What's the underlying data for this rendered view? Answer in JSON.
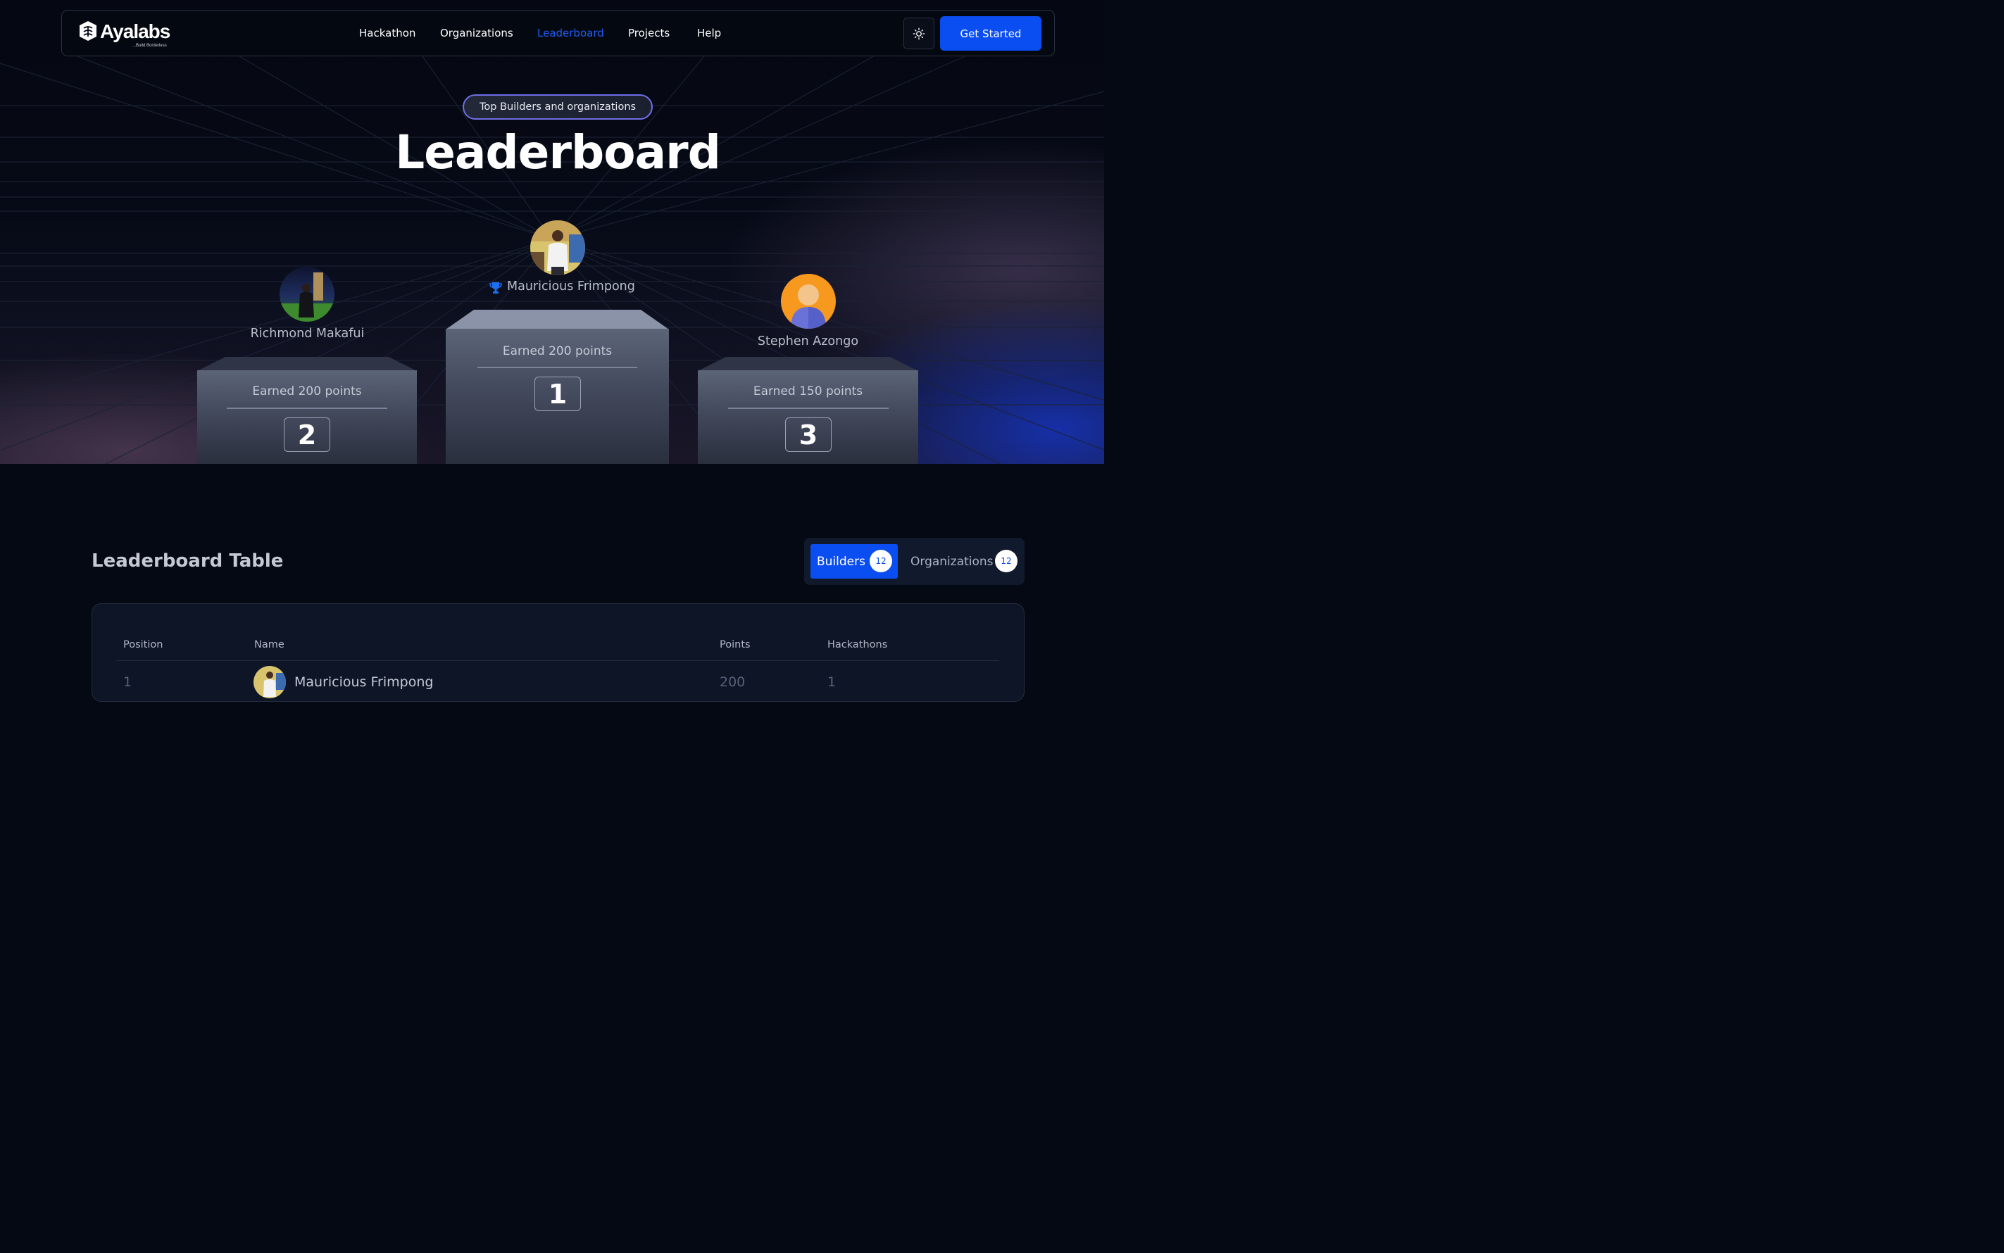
{
  "nav": {
    "logo_text": "Ayalabs",
    "logo_tagline": "...Build Borderless",
    "links": [
      {
        "label": "Hackathon",
        "active": false
      },
      {
        "label": "Organizations",
        "active": false
      },
      {
        "label": "Leaderboard",
        "active": true
      },
      {
        "label": "Projects",
        "active": false
      },
      {
        "label": "Help",
        "active": false
      }
    ],
    "theme_icon": "sun-icon",
    "cta_label": "Get Started"
  },
  "hero": {
    "pill": "Top Builders and organizations",
    "title": "Leaderboard"
  },
  "podium": {
    "first": {
      "name": "Mauricious Frimpong",
      "points_label": "Earned 200 points",
      "rank": "1",
      "icon": "trophy-icon"
    },
    "second": {
      "name": "Richmond Makafui",
      "points_label": "Earned 200 points",
      "rank": "2"
    },
    "third": {
      "name": "Stephen Azongo",
      "points_label": "Earned 150 points",
      "rank": "3"
    }
  },
  "table_section": {
    "title": "Leaderboard Table",
    "tabs": [
      {
        "label": "Builders",
        "count": "12",
        "active": true
      },
      {
        "label": "Organizations",
        "count": "12",
        "active": false
      }
    ],
    "columns": [
      "Position",
      "Name",
      "Points",
      "Hackathons"
    ],
    "rows": [
      {
        "position": "1",
        "name": "Mauricious Frimpong",
        "points": "200",
        "hackathons": "1"
      }
    ]
  },
  "colors": {
    "accent": "#0a4df0",
    "active_link": "#1f5cf0",
    "background": "#050913",
    "pill_border": "#6f6ee6"
  }
}
